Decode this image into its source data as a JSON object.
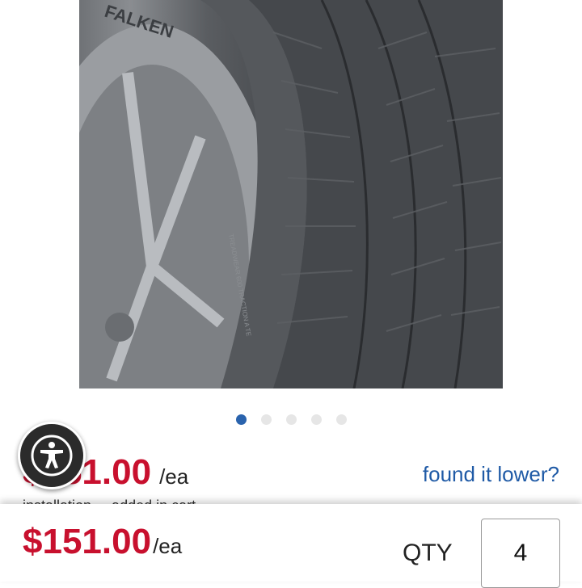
{
  "product": {
    "image_alt": "Falken tire",
    "brand_sidewall": "FALKEN",
    "sidewall_text": "TREADWEAR 600   TRACTION A   TE"
  },
  "carousel": {
    "count": 5,
    "active_index": 0
  },
  "pricing": {
    "price": "$151.00",
    "per_unit": "/ea",
    "found_lower": "found it lower?",
    "subline": "installation ... added in cart"
  },
  "sticky_bar": {
    "price": "$151.00",
    "per_unit": "/ea",
    "qty_label": "QTY",
    "qty_value": "4"
  },
  "colors": {
    "price": "#c8102e",
    "link": "#1f5aa6",
    "dot_active": "#2a63ad"
  }
}
